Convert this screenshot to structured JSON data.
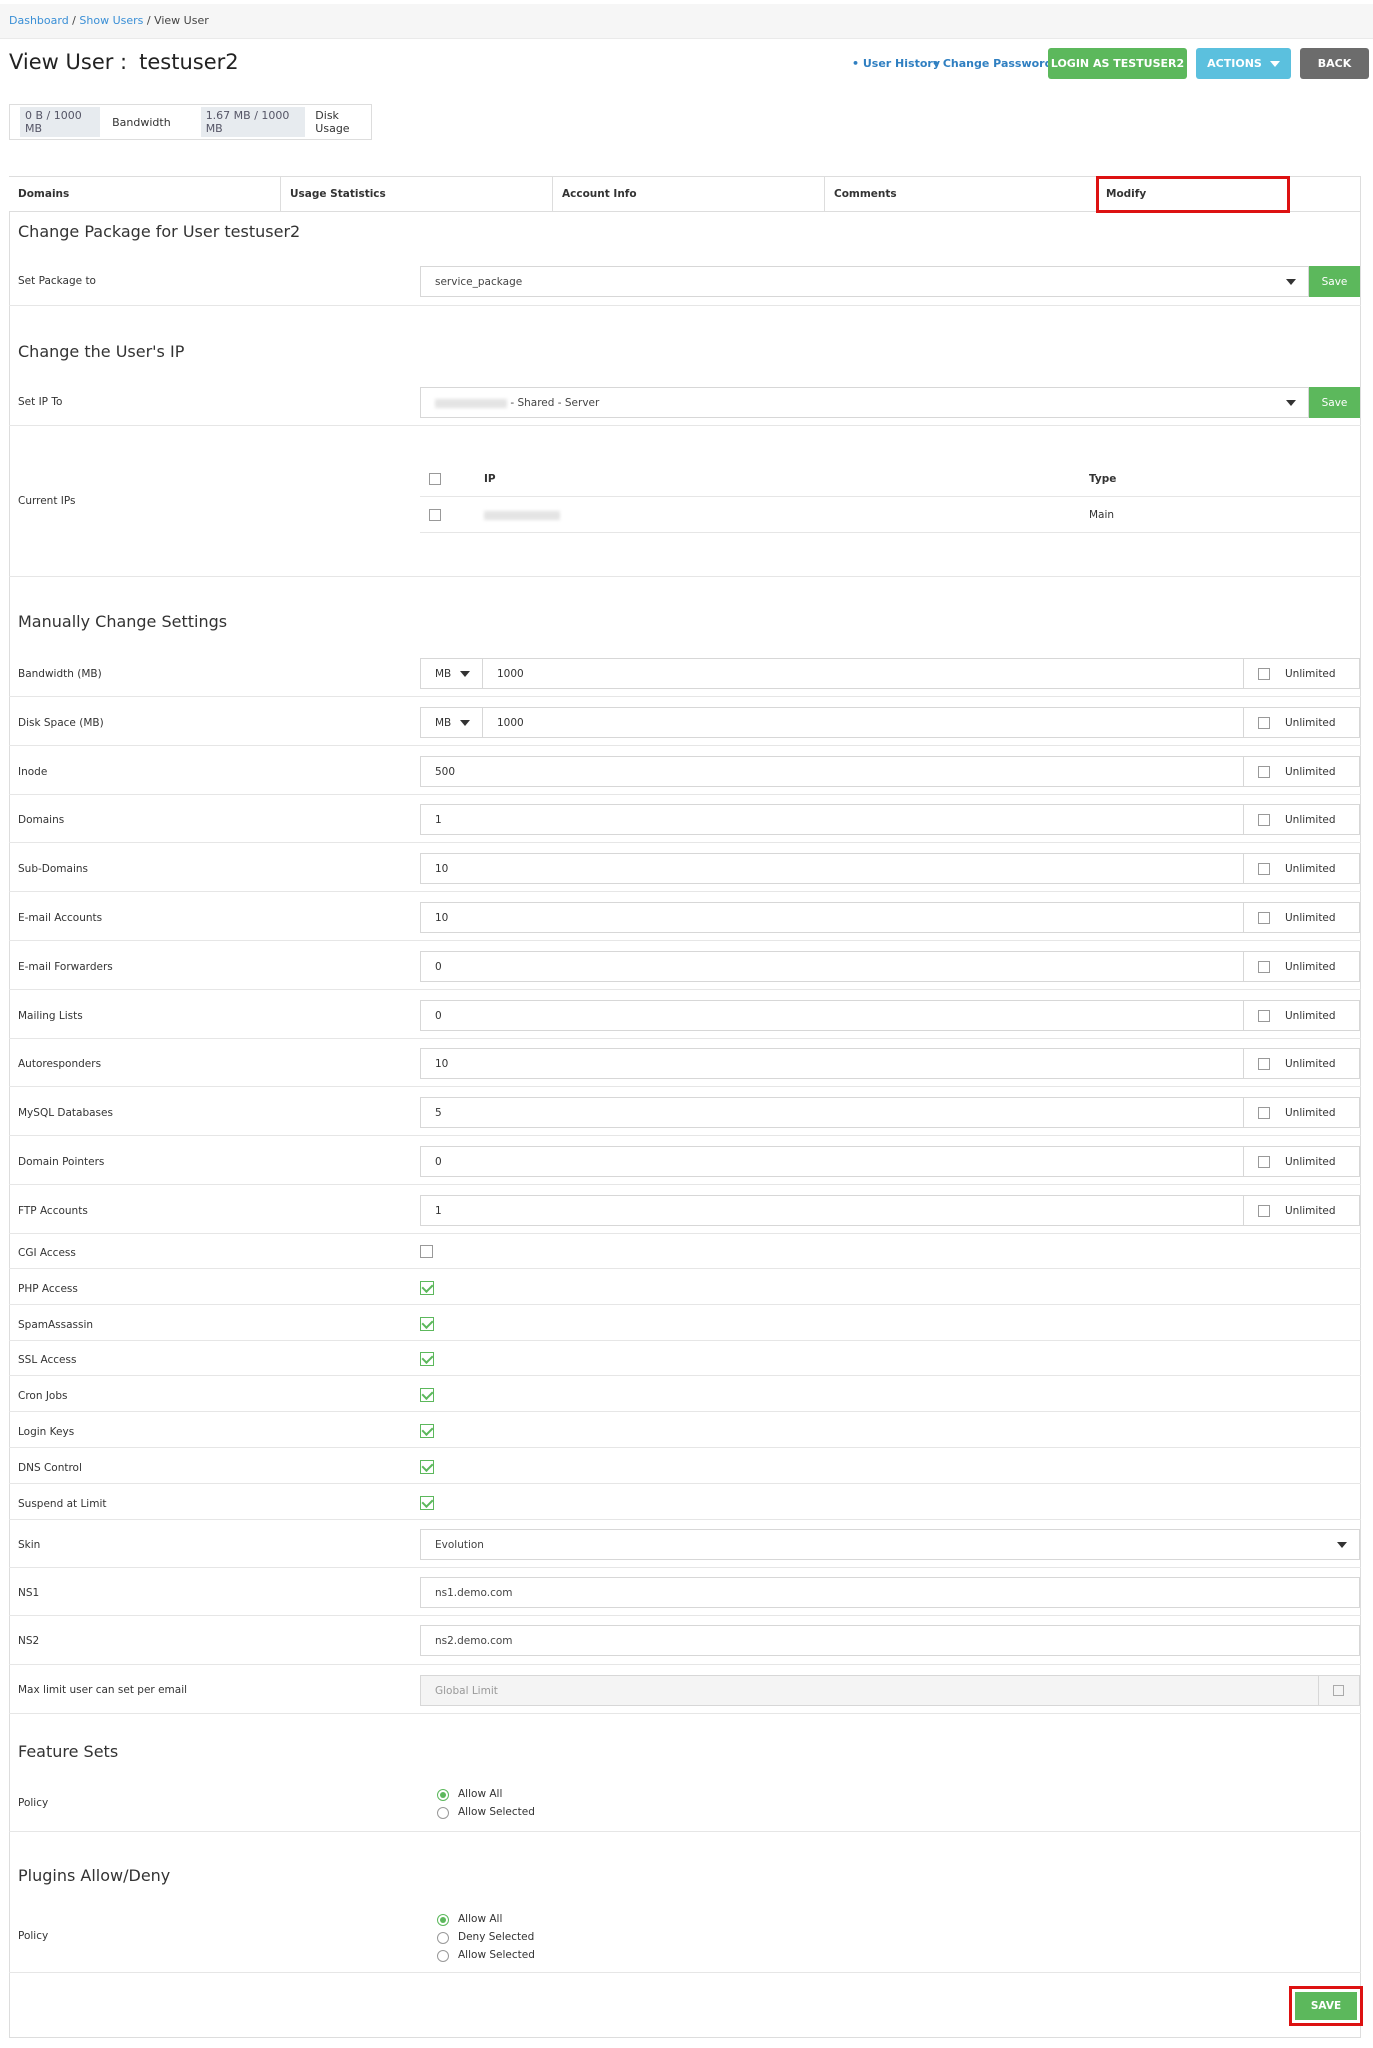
{
  "breadcrumb": {
    "dashboard": "Dashboard",
    "sep1": " / ",
    "show_users": "Show Users",
    "sep2": " / ",
    "current": "View User"
  },
  "header": {
    "title": "View User :",
    "username": "testuser2",
    "user_history": "• User History",
    "change_password": "• Change Password",
    "login_as": "LOGIN AS TESTUSER2",
    "actions": "ACTIONS",
    "back": "BACK"
  },
  "usage": {
    "bandwidth_value": "0 B / 1000 MB",
    "bandwidth_label": "Bandwidth",
    "disk_value": "1.67 MB / 1000 MB",
    "disk_label": "Disk Usage"
  },
  "tabs": [
    "Domains",
    "Usage Statistics",
    "Account Info",
    "Comments",
    "Modify"
  ],
  "package": {
    "heading": "Change Package for User testuser2",
    "label": "Set Package to",
    "value": "service_package",
    "save": "Save"
  },
  "ip": {
    "heading": "Change the User's IP",
    "label": "Set IP To",
    "value_suffix": " - Shared - Server",
    "save": "Save",
    "current_label": "Current IPs",
    "col_ip": "IP",
    "col_type": "Type",
    "row_type": "Main"
  },
  "manual": {
    "heading": "Manually Change Settings",
    "unit": "MB",
    "unlimited": "Unlimited",
    "rows": [
      {
        "label": "Bandwidth (MB)",
        "value": "1000"
      },
      {
        "label": "Disk Space (MB)",
        "value": "1000"
      },
      {
        "label": "Inode",
        "value": "500"
      },
      {
        "label": "Domains",
        "value": "1"
      },
      {
        "label": "Sub-Domains",
        "value": "10"
      },
      {
        "label": "E-mail Accounts",
        "value": "10"
      },
      {
        "label": "E-mail Forwarders",
        "value": "0"
      },
      {
        "label": "Mailing Lists",
        "value": "0"
      },
      {
        "label": "Autoresponders",
        "value": "10"
      },
      {
        "label": "MySQL Databases",
        "value": "5"
      },
      {
        "label": "Domain Pointers",
        "value": "0"
      },
      {
        "label": "FTP Accounts",
        "value": "1"
      }
    ],
    "checks": [
      {
        "label": "CGI Access",
        "checked": false
      },
      {
        "label": "PHP Access",
        "checked": true
      },
      {
        "label": "SpamAssassin",
        "checked": true
      },
      {
        "label": "SSL Access",
        "checked": true
      },
      {
        "label": "Cron Jobs",
        "checked": true
      },
      {
        "label": "Login Keys",
        "checked": true
      },
      {
        "label": "DNS Control",
        "checked": true
      },
      {
        "label": "Suspend at Limit",
        "checked": true
      }
    ],
    "skin_label": "Skin",
    "skin_value": "Evolution",
    "ns1_label": "NS1",
    "ns1_value": "ns1.demo.com",
    "ns2_label": "NS2",
    "ns2_value": "ns2.demo.com",
    "maxlimit_label": "Max limit user can set per email",
    "maxlimit_placeholder": "Global Limit"
  },
  "feature_sets": {
    "heading": "Feature Sets",
    "policy": "Policy",
    "opt_allow_all": "Allow All",
    "opt_allow_selected": "Allow Selected"
  },
  "plugins": {
    "heading": "Plugins Allow/Deny",
    "policy": "Policy",
    "opt_allow_all": "Allow All",
    "opt_deny_selected": "Deny Selected",
    "opt_allow_selected": "Allow Selected"
  },
  "footer": {
    "save": "SAVE"
  },
  "colors": {
    "green": "#5cb85c",
    "blue": "#5bc0de",
    "dark": "#6c6c6c",
    "highlight": "#dd1111",
    "link": "#2f7fc1"
  }
}
